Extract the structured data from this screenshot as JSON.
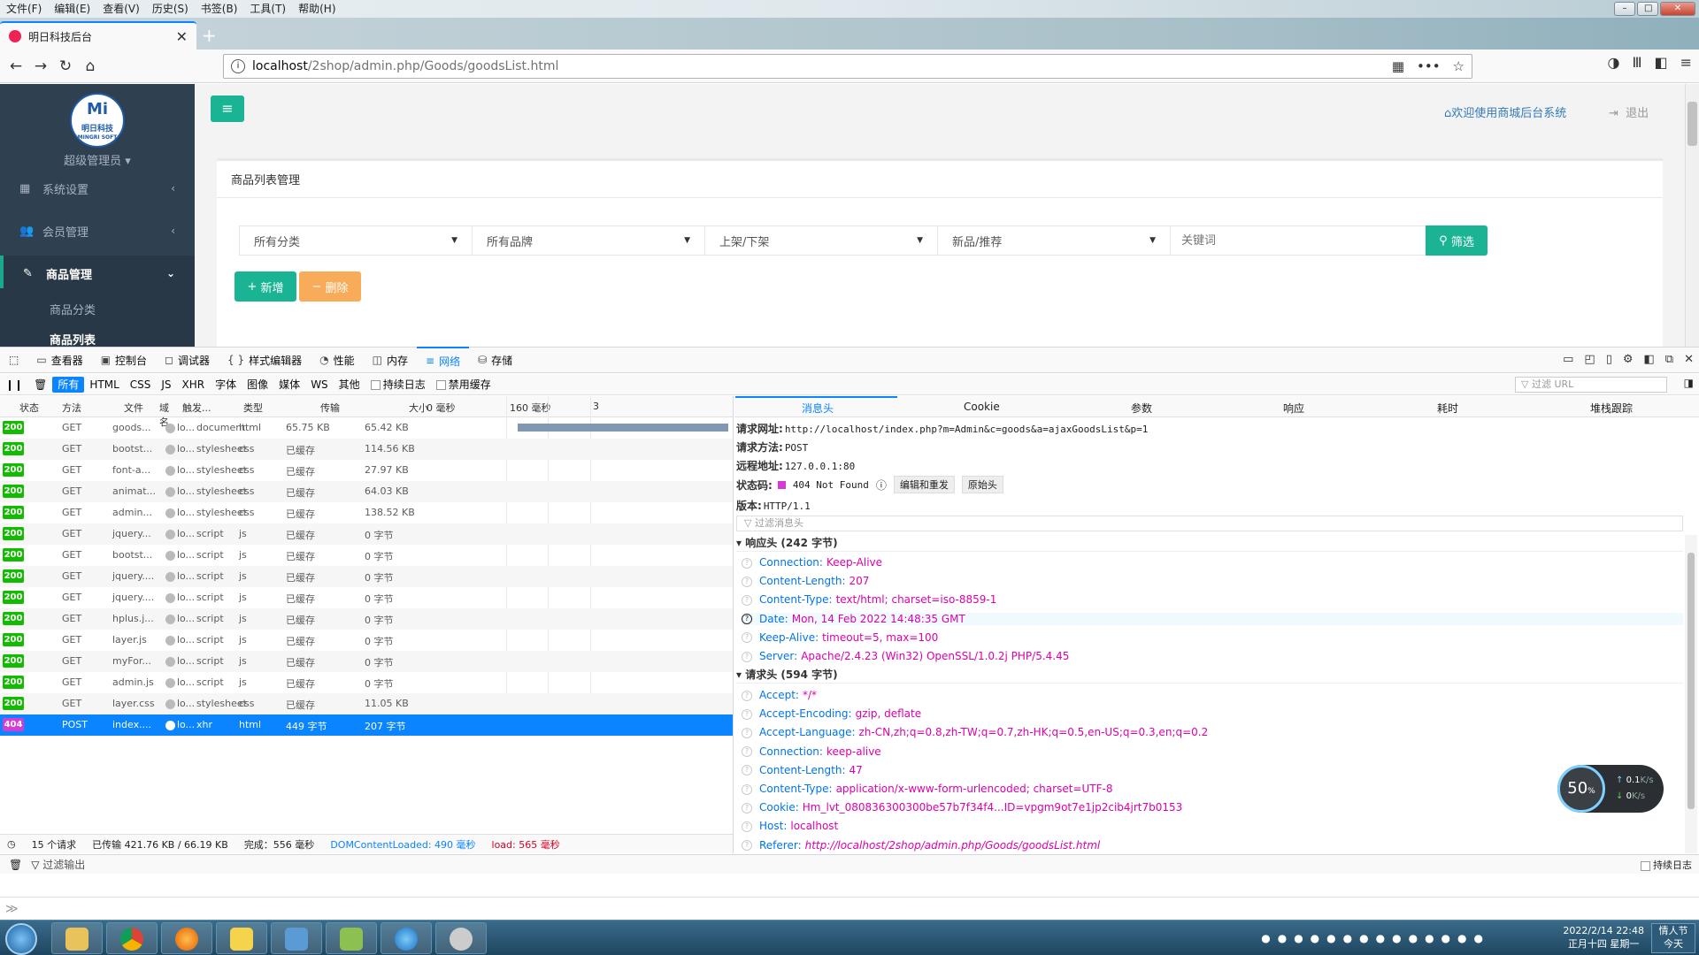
{
  "menu": [
    "文件(F)",
    "编辑(E)",
    "查看(V)",
    "历史(S)",
    "书签(B)",
    "工具(T)",
    "帮助(H)"
  ],
  "tab": {
    "title": "明日科技后台"
  },
  "url": {
    "host": "localhost",
    "path": "/2shop/admin.php/Goods/goodsList.html"
  },
  "sidebar": {
    "logo_text": "明日科技",
    "logo_sub": "MINGRI SOFT",
    "role": "超级管理员",
    "items": [
      {
        "label": "系统设置"
      },
      {
        "label": "会员管理"
      },
      {
        "label": "商品管理"
      }
    ],
    "subitems": [
      {
        "label": "商品分类"
      },
      {
        "label": "商品列表"
      }
    ]
  },
  "header": {
    "welcome": "欢迎使用商城后台系统",
    "logout": "退出"
  },
  "panel": {
    "title": "商品列表管理",
    "filters": {
      "category": "所有分类",
      "brand": "所有品牌",
      "shelf": "上架/下架",
      "flag": "新品/推荐"
    },
    "keyword_placeholder": "关键词",
    "filter_btn": "筛选",
    "add_btn": "新增",
    "delete_btn": "删除"
  },
  "devtools": {
    "tabs": [
      "查看器",
      "控制台",
      "调试器",
      "样式编辑器",
      "性能",
      "内存",
      "网络",
      "存储"
    ],
    "selected_tab": "网络",
    "net_filters": [
      "所有",
      "HTML",
      "CSS",
      "JS",
      "XHR",
      "字体",
      "图像",
      "媒体",
      "WS",
      "其他"
    ],
    "persist_log": "持续日志",
    "disable_cache": "禁用缓存",
    "url_filter_placeholder": "过滤 URL",
    "columns": {
      "status": "状态",
      "method": "方法",
      "file": "文件",
      "domain": "域名",
      "cause": "触发...",
      "type": "类型",
      "transferred": "传输",
      "size": "大小",
      "t0": "0 毫秒",
      "t1": "160 毫秒",
      "t2": "3"
    },
    "requests": [
      {
        "status": "200",
        "method": "GET",
        "file": "goods...",
        "domain": "lo...",
        "cause": "document",
        "type": "html",
        "transferred": "65.75 KB",
        "size": "65.42 KB"
      },
      {
        "status": "200",
        "method": "GET",
        "file": "bootst...",
        "domain": "lo...",
        "cause": "stylesheet",
        "type": "css",
        "transferred": "已缓存",
        "size": "114.56 KB"
      },
      {
        "status": "200",
        "method": "GET",
        "file": "font-a...",
        "domain": "lo...",
        "cause": "stylesheet",
        "type": "css",
        "transferred": "已缓存",
        "size": "27.97 KB"
      },
      {
        "status": "200",
        "method": "GET",
        "file": "animat...",
        "domain": "lo...",
        "cause": "stylesheet",
        "type": "css",
        "transferred": "已缓存",
        "size": "64.03 KB"
      },
      {
        "status": "200",
        "method": "GET",
        "file": "admin...",
        "domain": "lo...",
        "cause": "stylesheet",
        "type": "css",
        "transferred": "已缓存",
        "size": "138.52 KB"
      },
      {
        "status": "200",
        "method": "GET",
        "file": "jquery...",
        "domain": "lo...",
        "cause": "script",
        "type": "js",
        "transferred": "已缓存",
        "size": "0 字节"
      },
      {
        "status": "200",
        "method": "GET",
        "file": "bootst...",
        "domain": "lo...",
        "cause": "script",
        "type": "js",
        "transferred": "已缓存",
        "size": "0 字节"
      },
      {
        "status": "200",
        "method": "GET",
        "file": "jquery....",
        "domain": "lo...",
        "cause": "script",
        "type": "js",
        "transferred": "已缓存",
        "size": "0 字节"
      },
      {
        "status": "200",
        "method": "GET",
        "file": "jquery....",
        "domain": "lo...",
        "cause": "script",
        "type": "js",
        "transferred": "已缓存",
        "size": "0 字节"
      },
      {
        "status": "200",
        "method": "GET",
        "file": "hplus.j...",
        "domain": "lo...",
        "cause": "script",
        "type": "js",
        "transferred": "已缓存",
        "size": "0 字节"
      },
      {
        "status": "200",
        "method": "GET",
        "file": "layer.js",
        "domain": "lo...",
        "cause": "script",
        "type": "js",
        "transferred": "已缓存",
        "size": "0 字节"
      },
      {
        "status": "200",
        "method": "GET",
        "file": "myFor...",
        "domain": "lo...",
        "cause": "script",
        "type": "js",
        "transferred": "已缓存",
        "size": "0 字节"
      },
      {
        "status": "200",
        "method": "GET",
        "file": "admin.js",
        "domain": "lo...",
        "cause": "script",
        "type": "js",
        "transferred": "已缓存",
        "size": "0 字节"
      },
      {
        "status": "200",
        "method": "GET",
        "file": "layer.css",
        "domain": "lo...",
        "cause": "stylesheet",
        "type": "css",
        "transferred": "已缓存",
        "size": "11.05 KB"
      },
      {
        "status": "404",
        "method": "POST",
        "file": "index....",
        "domain": "lo...",
        "cause": "xhr",
        "type": "html",
        "transferred": "449 字节",
        "size": "207 字节"
      }
    ],
    "footer": {
      "count": "15 个请求",
      "transferred": "已传输 421.76 KB / 66.19 KB",
      "finish": "完成：556 毫秒",
      "dcl": "DOMContentLoaded: 490 毫秒",
      "load": "load: 565 毫秒"
    },
    "details": {
      "tabs": [
        "消息头",
        "Cookie",
        "参数",
        "响应",
        "耗时",
        "堆栈跟踪"
      ],
      "request_url_label": "请求网址:",
      "request_url": "http://localhost/index.php?m=Admin&c=goods&a=ajaxGoodsList&p=1",
      "method_label": "请求方法:",
      "method": "POST",
      "remote_label": "远程地址:",
      "remote": "127.0.0.1:80",
      "status_label": "状态码:",
      "status": "404 Not Found",
      "edit_resend": "编辑和重发",
      "raw_headers": "原始头",
      "version_label": "版本:",
      "version": "HTTP/1.1",
      "filter_headers": "过滤消息头",
      "response_section": "响应头 (242 字节)",
      "response_headers": [
        {
          "k": "Connection:",
          "v": "Keep-Alive"
        },
        {
          "k": "Content-Length:",
          "v": "207"
        },
        {
          "k": "Content-Type:",
          "v": "text/html; charset=iso-8859-1"
        },
        {
          "k": "Date:",
          "v": "Mon, 14 Feb 2022 14:48:35 GMT"
        },
        {
          "k": "Keep-Alive:",
          "v": "timeout=5, max=100"
        },
        {
          "k": "Server:",
          "v": "Apache/2.4.23 (Win32) OpenSSL/1.0.2j PHP/5.4.45"
        }
      ],
      "request_section": "请求头 (594 字节)",
      "request_headers": [
        {
          "k": "Accept:",
          "v": "*/*"
        },
        {
          "k": "Accept-Encoding:",
          "v": "gzip, deflate"
        },
        {
          "k": "Accept-Language:",
          "v": "zh-CN,zh;q=0.8,zh-TW;q=0.7,zh-HK;q=0.5,en-US;q=0.3,en;q=0.2"
        },
        {
          "k": "Connection:",
          "v": "keep-alive"
        },
        {
          "k": "Content-Length:",
          "v": "47"
        },
        {
          "k": "Content-Type:",
          "v": "application/x-www-form-urlencoded; charset=UTF-8"
        },
        {
          "k": "Cookie:",
          "v": "Hm_lvt_080836300300be57b7f34f4...ID=vpgm9ot7e1jp2cib4jrt7b0153"
        },
        {
          "k": "Host:",
          "v": "localhost"
        },
        {
          "k": "Referer:",
          "v": "http://localhost/2shop/admin.php/Goods/goodsList.html"
        }
      ]
    },
    "console_filter": "过滤输出",
    "console_persist": "持续日志"
  },
  "speed_widget": {
    "percent": "50",
    "unit": "%",
    "up": "0.1",
    "down": "0",
    "rate_unit": "K/s"
  },
  "taskbar": {
    "date": "2022/2/14 22:48",
    "lunar": "正月十四 星期一",
    "show_desktop": "情人节",
    "today": "今天"
  },
  "colors": {
    "accent": "#1ab394",
    "warning": "#f8ac59",
    "sidebar": "#2f4050",
    "devtools_blue": "#0a84ff",
    "ok": "#12bc00",
    "error": "#d63bd3"
  }
}
